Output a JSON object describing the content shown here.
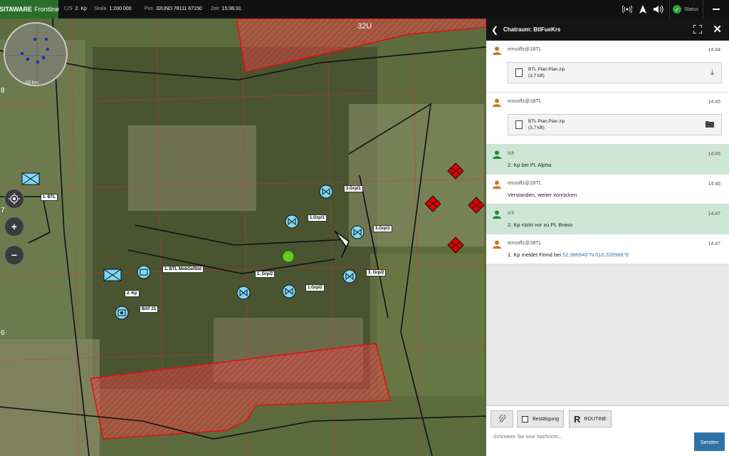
{
  "topbar": {
    "brand": "SITAWARE",
    "brand_sub": "Frontline",
    "callsign_label": "C/S",
    "callsign_value": "2. Kp",
    "scale_label": "Skala",
    "scale_value": "1:200.000",
    "pos_label": "Pos",
    "pos_value": "32UND 78111 67150",
    "time_label": "Zeit",
    "time_value": "15:36:31",
    "status_label": "Status",
    "icons": [
      "radio-icon",
      "north-arrow-icon",
      "volume-icon",
      "status-check-icon",
      "menu-icon"
    ]
  },
  "map": {
    "grid_zone": "32U",
    "minimap_scale": "10 km",
    "side_ticks": [
      "8",
      "7",
      "6"
    ],
    "unit_labels": [
      "1. BTL",
      "2.Grp/1",
      "1.Grp/1",
      "3.Grp/1",
      "1. BTL MobGefStd",
      "1. Grp/2",
      "3. Grp/2",
      "2. Kp",
      "1.Grp/2",
      "BAT 21"
    ],
    "controls": [
      "locate-icon",
      "zoom-in-icon",
      "zoom-out-icon"
    ],
    "colors": {
      "hostile": "#e00000",
      "friendly": "#80d8f8",
      "own": "#66cc22"
    }
  },
  "chat": {
    "title": "Chatraum: BtlFueKrs",
    "messages": [
      {
        "user": "einsoffz@1BTL",
        "time": "14:44",
        "type": "other",
        "attachment": {
          "name": "BTL Plan.Plan.zip",
          "size": "(3,7 kB)",
          "action": "download-icon"
        }
      },
      {
        "user": "einsoffz@1BTL",
        "time": "14:45",
        "type": "other",
        "attachment": {
          "name": "BTL Plan.Plan.zip",
          "size": "(3,7 kB)",
          "action": "folder-icon"
        }
      },
      {
        "user": "Ich",
        "time": "14:46",
        "type": "me",
        "text": "2. Kp bei PL Alpha"
      },
      {
        "user": "einsoffz@1BTL",
        "time": "14:46",
        "type": "other",
        "text": "Verstanden, weiter vorrücken"
      },
      {
        "user": "Ich",
        "time": "14:47",
        "type": "me",
        "text": "2. Kp rückt vor zu PL Bravo"
      },
      {
        "user": "einsoffz@1BTL",
        "time": "14:47",
        "type": "other",
        "text": "1. Kp meldet Feind bei ",
        "coord": "52.986945°N 010.339966°E"
      }
    ],
    "composer": {
      "bestaetigung": "Bestätigung",
      "routine_letter": "R",
      "routine": "ROUTINE",
      "placeholder": "Schreiben Sie eine Nachricht...",
      "send": "Senden"
    }
  }
}
